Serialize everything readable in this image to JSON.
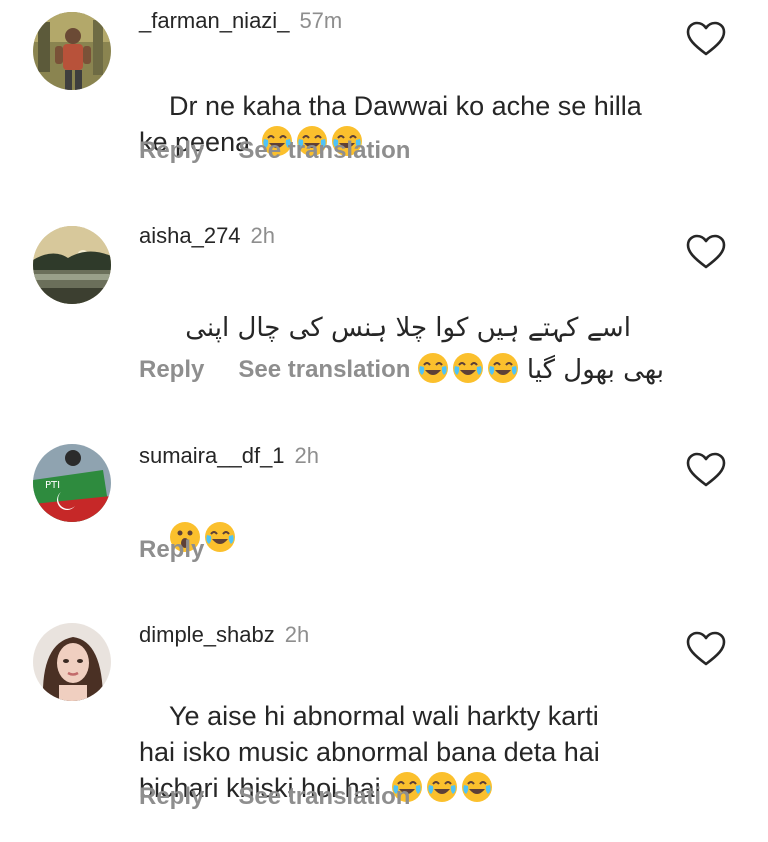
{
  "comments": [
    {
      "username": "_farman_niazi_",
      "time": "57m",
      "text": "Dr ne kaha tha Dawwai ko ache se hilla ke peena",
      "emojis": [
        "joy",
        "joy",
        "joy"
      ],
      "reply_label": "Reply",
      "translate_label": "See translation"
    },
    {
      "username": "aisha_274",
      "time": "2h",
      "text": "اسے کہتے ہیں کوا چلا ہنس کی چال اپنی بھی بھول گیا",
      "emojis": [
        "joy",
        "joy",
        "joy"
      ],
      "reply_label": "Reply",
      "translate_label": "See translation"
    },
    {
      "username": "sumaira__df_1",
      "time": "2h",
      "text": "",
      "emojis": [
        "astonished",
        "joy"
      ],
      "reply_label": "Reply"
    },
    {
      "username": "dimple_shabz",
      "time": "2h",
      "text": "Ye aise hi abnormal wali harkty karti hai isko music abnormal bana deta hai bichari khiski hoi hai",
      "emojis": [
        "joy",
        "joy",
        "joy"
      ],
      "reply_label": "Reply",
      "translate_label": "See translation"
    }
  ],
  "colors": {
    "username": "#262626",
    "secondary": "#8e8e8e",
    "emoji_face": "#fbc02d"
  },
  "icons": {
    "like": "heart-outline-icon",
    "laugh": "face-with-tears-of-joy-icon",
    "wow": "astonished-face-icon"
  }
}
